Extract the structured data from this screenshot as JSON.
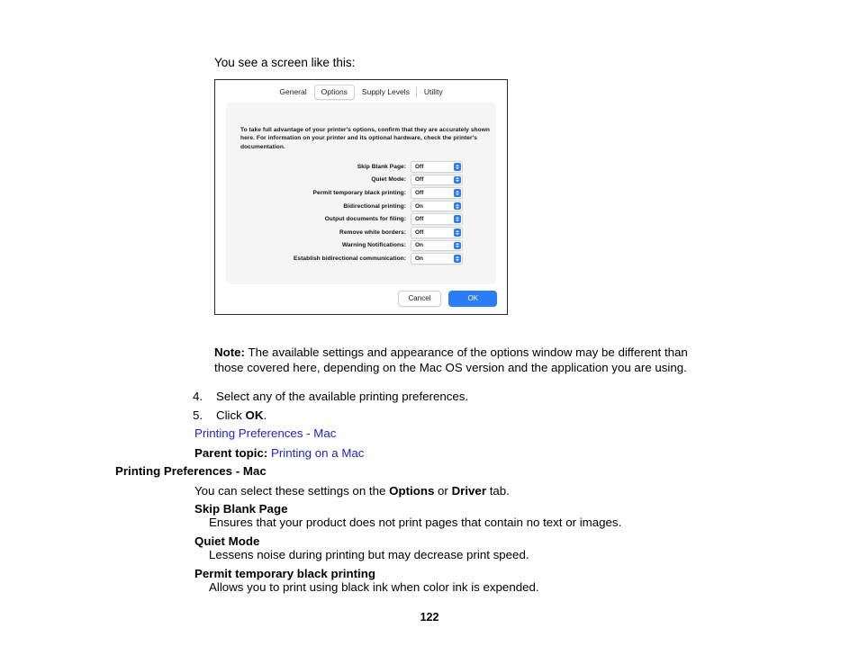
{
  "document": {
    "intro_line": "You see a screen like this:",
    "page_number": "122"
  },
  "figure": {
    "tabs": [
      {
        "label": "General",
        "selected": false
      },
      {
        "label": "Options",
        "selected": true
      },
      {
        "label": "Supply Levels",
        "selected": false
      },
      {
        "label": "Utility",
        "selected": false
      }
    ],
    "description": "To take full advantage of your printer's options, confirm that they are accurately shown here. For information on your printer and its optional hardware, check the printer's documentation.",
    "settings": [
      {
        "label": "Skip Blank Page:",
        "value": "Off"
      },
      {
        "label": "Quiet Mode:",
        "value": "Off"
      },
      {
        "label": "Permit temporary black printing:",
        "value": "Off"
      },
      {
        "label": "Bidirectional printing:",
        "value": "On"
      },
      {
        "label": "Output documents for filing:",
        "value": "Off"
      },
      {
        "label": "Remove white borders:",
        "value": "Off"
      },
      {
        "label": "Warning Notifications:",
        "value": "On"
      },
      {
        "label": "Establish bidirectional communication:",
        "value": "On"
      }
    ],
    "cancel_label": "Cancel",
    "ok_label": "OK",
    "accent_color": "#2a7df4"
  },
  "note": {
    "label": "Note:",
    "text": "The available settings and appearance of the options window may be different than those covered here, depending on the Mac OS version and the application you are using."
  },
  "steps": [
    {
      "number": "4.",
      "text": "Select any of the available printing preferences.",
      "prefix": "",
      "bold": "",
      "suffix": ""
    },
    {
      "number": "5.",
      "text": "",
      "prefix": "Click ",
      "bold": "OK",
      "suffix": "."
    }
  ],
  "links": {
    "printing_preferences_mac": "Printing Preferences - Mac",
    "parent_topic_label": "Parent topic:",
    "parent_topic_link": "Printing on a Mac",
    "link_color": "#2222cc"
  },
  "section": {
    "heading": "Printing Preferences - Mac",
    "intro_prefix": "You can select these settings on the ",
    "intro_bold1": "Options",
    "intro_middle": " or ",
    "intro_bold2": "Driver",
    "intro_suffix": " tab."
  },
  "definitions": [
    {
      "term": "Skip Blank Page",
      "description": "Ensures that your product does not print pages that contain no text or images."
    },
    {
      "term": "Quiet Mode",
      "description": "Lessens noise during printing but may decrease print speed."
    },
    {
      "term": "Permit temporary black printing",
      "description": "Allows you to print using black ink when color ink is expended."
    }
  ]
}
